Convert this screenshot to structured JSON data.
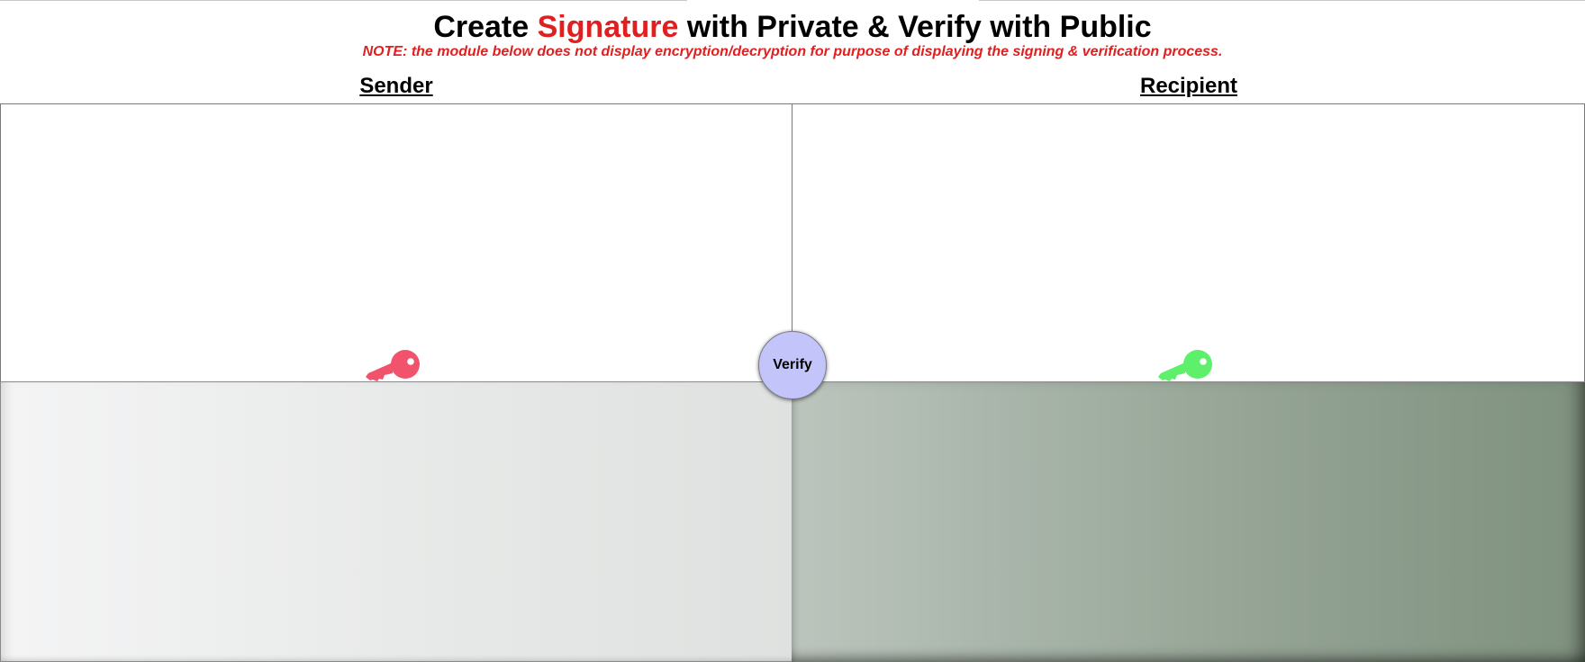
{
  "title": {
    "prefix": "Create ",
    "accent": "Signature",
    "suffix": " with Private & Verify with Public"
  },
  "note": "NOTE: the module below does not display encryption/decryption for purpose of displaying the signing & verification process.",
  "sender": {
    "label": "Sender",
    "key_icon": "key-icon",
    "key_color": "#f2536c"
  },
  "recipient": {
    "label": "Recipient",
    "key_icon": "key-icon",
    "key_color": "#5ef06a"
  },
  "verify_button": {
    "label": "Verify",
    "color": "#c3c4f9"
  },
  "colors": {
    "accent_red": "#e02020"
  }
}
